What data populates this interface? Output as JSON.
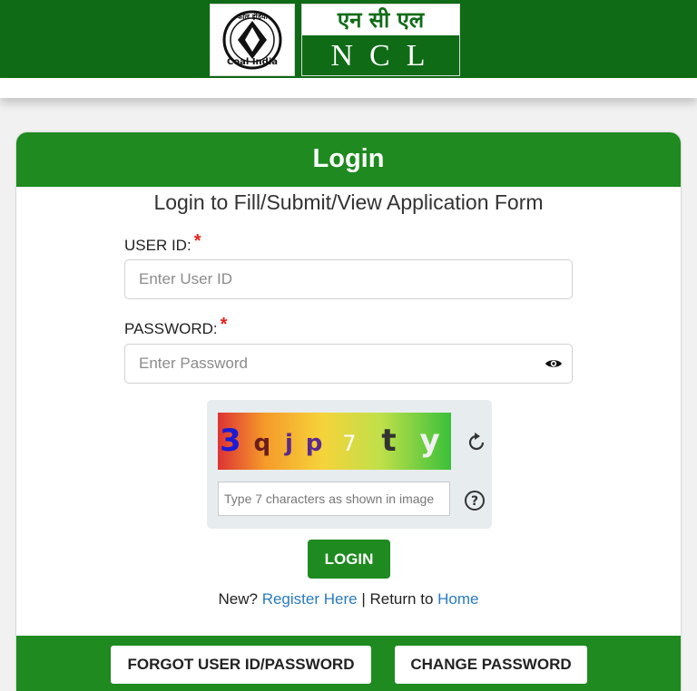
{
  "header": {
    "logo_text": "कोल इंडिया Coal India",
    "org_hindi": "एन सी एल",
    "org_short": "NCL"
  },
  "card": {
    "title": "Login",
    "subtitle": "Login to Fill/Submit/View Application Form",
    "user_label": "USER ID:",
    "user_placeholder": "Enter User ID",
    "password_label": "PASSWORD:",
    "password_placeholder": "Enter Password",
    "required_mark": "*",
    "captcha_code": "3qjp7ty",
    "captcha_placeholder": "Type 7 characters as shown in image",
    "login_button": "LOGIN",
    "new_text": "New?",
    "register_link": "Register Here",
    "separator": "|",
    "return_text": "Return to",
    "home_link": "Home"
  },
  "footer": {
    "forgot_button": "FORGOT USER ID/PASSWORD",
    "change_button": "CHANGE PASSWORD"
  },
  "colors": {
    "header_green": "#0f6b16",
    "card_green": "#1e8a1f",
    "required_red": "#e5211b",
    "link_blue": "#2a7bbf"
  },
  "icons": {
    "visibility": "eye-icon",
    "captcha_refresh": "refresh-icon",
    "captcha_help": "help-icon"
  }
}
